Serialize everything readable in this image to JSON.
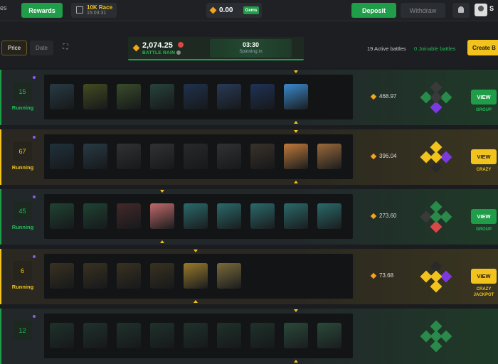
{
  "topbar": {
    "games_label": "es",
    "rewards_label": "Rewards",
    "race_title": "10K Race",
    "race_timer": "15:03:31",
    "balance": "0.00",
    "gems_label": "Gems",
    "deposit_label": "Deposit",
    "withdraw_label": "Withdraw",
    "username": "S"
  },
  "filters": {
    "price_label": "Price",
    "date_label": "Date"
  },
  "rain": {
    "amount": "2,074.25",
    "label": "BATTLE RAIN",
    "timer": "03:30",
    "timer_label": "Spinning in"
  },
  "battles_header": {
    "active": "19 Active battles",
    "joinable": "0 Joinable battles",
    "create_label": "Create B"
  },
  "battles": [
    {
      "count": "15",
      "status": "Running",
      "value": "468.97",
      "view_label": "VIEW",
      "mode": "GROUP",
      "mode2": "",
      "theme": "green"
    },
    {
      "count": "67",
      "status": "Running",
      "value": "396.04",
      "view_label": "VIEW",
      "mode": "CRAZY",
      "mode2": "",
      "theme": "gold"
    },
    {
      "count": "45",
      "status": "Running",
      "value": "273.60",
      "view_label": "VIEW",
      "mode": "GROUP",
      "mode2": "",
      "theme": "green"
    },
    {
      "count": "6",
      "status": "Running",
      "value": "73.68",
      "view_label": "VIEW",
      "mode": "CRAZY",
      "mode2": "JACKPOT",
      "theme": "gold"
    },
    {
      "count": "12",
      "status": "",
      "value": "",
      "view_label": "",
      "mode": "",
      "mode2": "",
      "theme": "green"
    }
  ],
  "colors": {
    "green": "#1f9d48",
    "gold": "#f3c31d",
    "text_green": "#1fbf55",
    "text_gold": "#f3c31d"
  }
}
